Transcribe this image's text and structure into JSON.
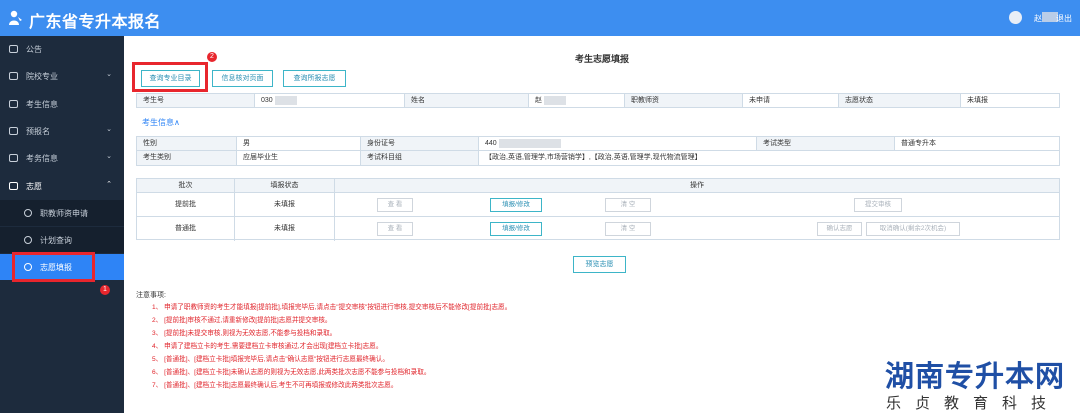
{
  "app": {
    "title": "广东省专升本报名",
    "user_name": "赵",
    "logout": "退出"
  },
  "sidebar": {
    "items": [
      {
        "label": "公告",
        "icon": "notice-icon"
      },
      {
        "label": "院校专业",
        "icon": "school-icon",
        "chevron": "⌄"
      },
      {
        "label": "考生信息",
        "icon": "user-info-icon"
      },
      {
        "label": "预报名",
        "icon": "pre-register-icon",
        "chevron": "⌄"
      },
      {
        "label": "考务信息",
        "icon": "exam-info-icon",
        "chevron": "⌄"
      },
      {
        "label": "志愿",
        "icon": "volunteer-icon",
        "chevron": "⌃"
      }
    ],
    "sub_items": [
      {
        "label": "职教师资申请"
      },
      {
        "label": "计划查询"
      },
      {
        "label": "志愿填报"
      }
    ]
  },
  "page": {
    "title": "考生志愿填报",
    "toolbar": {
      "query_major": "查询专业目录",
      "info_check": "信息核对页面",
      "query_volunteer": "查询所报志愿"
    },
    "badges": {
      "one": "1",
      "two": "2"
    },
    "summary": {
      "exam_no_label": "考生号",
      "exam_no_value": "030",
      "name_label": "姓名",
      "name_value": "赵",
      "teacher_label": "职教师资",
      "teacher_value": "未申请",
      "status_label": "志愿状态",
      "status_value": "未填报"
    },
    "section_link": "考生信息∧",
    "info": {
      "gender_label": "性别",
      "gender_value": "男",
      "id_label": "身份证号",
      "id_value": "440",
      "exam_type_label": "考试类型",
      "exam_type_value": "普通专升本",
      "category_label": "考生类别",
      "category_value": "应届毕业生",
      "subjects_label": "考试科目组",
      "subjects_value": "【政治,英语,管理学,市场营销学】,【政治,英语,管理学,现代物流管理】"
    },
    "ops": {
      "batch_header": "批次",
      "status_header": "填报状态",
      "action_header": "操作",
      "rows": [
        {
          "batch": "提前批",
          "status": "未填报",
          "view": "查 看",
          "edit": "填报/修改",
          "clear": "清 空",
          "submit": "提交审核"
        },
        {
          "batch": "普通批",
          "status": "未填报",
          "view": "查 看",
          "edit": "填报/修改",
          "clear": "清 空",
          "confirm": "确认志愿",
          "cancel": "取消确认(剩余2次机会)"
        }
      ]
    },
    "preview": "预览志愿",
    "notes_title": "注意事项:",
    "notes": [
      "1、 申请了职教师资的考生才能填报[提前批],填报完毕后,请点击\"提交审核\"按钮进行审核,提交审核后不能修改[提前批]志愿。",
      "2、 [提前批]审核不通过,请重新修改[提前批]志愿并提交审核。",
      "3、 [提前批]未提交审核,则视为无效志愿,不能参与投档和录取。",
      "4、 申请了建档立卡的考生,需要建档立卡审核通过,才会出现[建档立卡批]志愿。",
      "5、 [普通批]、[建档立卡批]填报完毕后,请点击\"确认志愿\"按钮进行志愿最终确认。",
      "6、 [普通批]、[建档立卡批]未确认志愿的则视为无效志愿,此两类批次志愿不能参与投档和录取。",
      "7、 [普通批]、[建档立卡批]志愿最终确认后,考生不可再填报或修改此两类批次志愿。"
    ]
  },
  "watermark": {
    "main": "湖南专升本网",
    "sub": "乐贞教育科技"
  },
  "colors": {
    "header": "#3d8ef0",
    "sidebar": "#1d2b3d",
    "active": "#2e84f6",
    "highlight": "#e8262d",
    "note_text": "#e0232a"
  }
}
